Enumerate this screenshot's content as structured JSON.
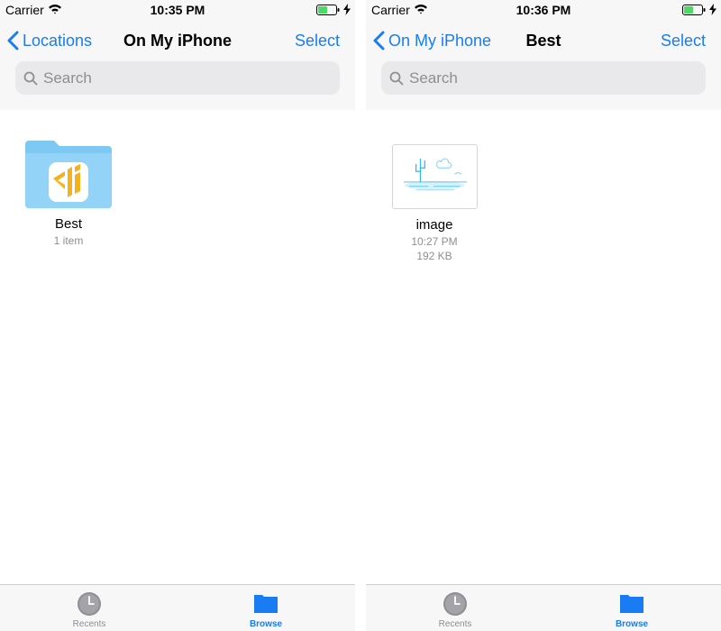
{
  "colors": {
    "accent": "#1a7cf3",
    "gray_text": "#8e8e93",
    "bar_bg": "#f7f7f7",
    "battery": "#4cd964",
    "folder": "#86cdf6",
    "app_icon": "#f5b21b"
  },
  "left": {
    "status": {
      "carrier": "Carrier",
      "time": "10:35 PM"
    },
    "nav": {
      "back_label": "Locations",
      "title": "On My iPhone",
      "select_label": "Select"
    },
    "search": {
      "placeholder": "Search"
    },
    "items": [
      {
        "name": "Best",
        "subtitle": "1 item",
        "icon": "folder-icon"
      }
    ],
    "tabs": [
      {
        "label": "Recents",
        "icon": "clock-icon"
      },
      {
        "label": "Browse",
        "icon": "folder-icon",
        "selected": true
      }
    ]
  },
  "right": {
    "status": {
      "carrier": "Carrier",
      "time": "10:36 PM"
    },
    "nav": {
      "back_label": "On My iPhone",
      "title": "Best",
      "select_label": "Select"
    },
    "search": {
      "placeholder": "Search"
    },
    "items": [
      {
        "name": "image",
        "time": "10:27 PM",
        "size": "192 KB",
        "icon": "image-thumbnail"
      }
    ],
    "tabs": [
      {
        "label": "Recents",
        "icon": "clock-icon"
      },
      {
        "label": "Browse",
        "icon": "folder-icon",
        "selected": true
      }
    ]
  }
}
